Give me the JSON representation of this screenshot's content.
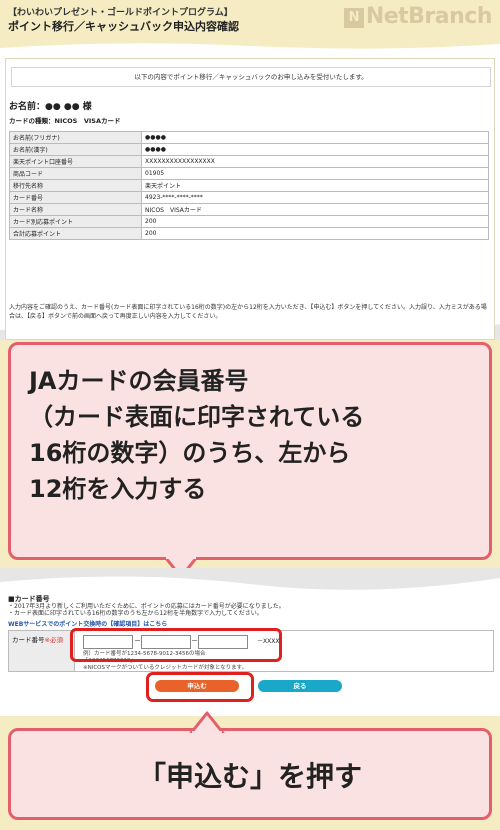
{
  "header": {
    "subtitle": "【わいわいプレゼント・ゴールドポイントプログラム】",
    "title": "ポイント移行／キャッシュバック申込内容確認",
    "logo_mark": "N",
    "logo_text": "NetBranch"
  },
  "confirm": {
    "notice": "以下の内容でポイント移行／キャッシュバックのお申し込みを受付いたします。",
    "name_line": "お名前：●● ●● 様",
    "card_type": "カードの種類：NICOS　VISAカード",
    "rows": [
      {
        "k": "お名前(フリガナ)",
        "v": "●●●●"
      },
      {
        "k": "お名前(漢字)",
        "v": "●●●●"
      },
      {
        "k": "楽天ポイント口座番号",
        "v": "XXXXXXXXXXXXXXXXX"
      },
      {
        "k": "商品コード",
        "v": "01905"
      },
      {
        "k": "移行先名称",
        "v": "楽天ポイント"
      },
      {
        "k": "カード番号",
        "v": "4923-****-****-****"
      },
      {
        "k": "カード名称",
        "v": "NICOS　VISAカード"
      },
      {
        "k": "カード別応募ポイント",
        "v": "200"
      },
      {
        "k": "合計応募ポイント",
        "v": "200"
      }
    ],
    "bottom_note": "入力内容をご確認のうえ、カード番号(カード表面に印字されている16桁の数字)の左から12桁を入力いただき、【申込む】ボタンを押してください。入力誤り、入力ミスがある場合は、【戻る】ボタンで前の画面へ戻って再度正しい内容を入力してください。"
  },
  "callout1": {
    "text": "JAカードの会員番号\n（カード表面に印字されている\n16桁の数字）のうち、左から\n12桁を入力する"
  },
  "card_number": {
    "title": "■カード番号",
    "note": "・2017年3月より新しくご利用いただくために、ポイントの応募にはカード番号が必要になりました。\n・カード表面に印字されている16桁の数字のうち左から12桁を半角数字で入力してください。",
    "link": "WEBサービスでのポイント交換時の【確認項目】はこちら",
    "label": "カード番号",
    "required": "※必須",
    "suffix": "－XXXX",
    "hint": "例）カード番号が1234-5678-9012-3456の場合\n「123456789012」\n※NICOSマークがついているクレジットカードが対象となります。"
  },
  "buttons": {
    "apply": "申込む",
    "back": "戻る"
  },
  "callout2": {
    "text": "「申込む」を押す"
  },
  "colors": {
    "page_bg": "#f6ecc4",
    "callout_bg": "#fbe2e2",
    "callout_border": "#e35f6c",
    "apply_button": "#e8622a",
    "back_button": "#1aa8c8",
    "highlight_ring": "#e0201e"
  }
}
